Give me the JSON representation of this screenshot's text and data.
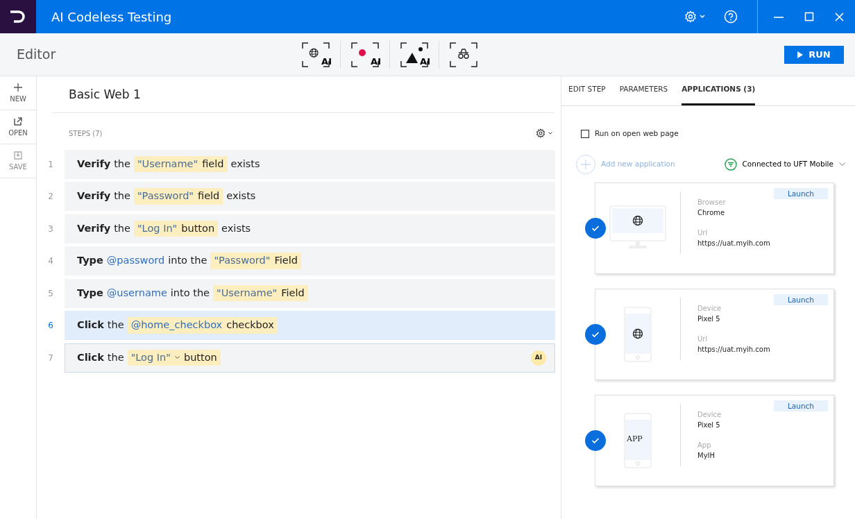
{
  "window": {
    "title": "AI Codeless Testing"
  },
  "toolbar": {
    "title": "Editor",
    "tools": [
      {
        "kind": "web",
        "label": "AI"
      },
      {
        "kind": "record",
        "label": "AI"
      },
      {
        "kind": "image",
        "label": "AI"
      },
      {
        "kind": "spy"
      }
    ],
    "run_button": "RUN"
  },
  "rail": [
    {
      "kind": "new",
      "label": "NEW",
      "disabled": false
    },
    {
      "kind": "open",
      "label": "OPEN",
      "disabled": false
    },
    {
      "kind": "save",
      "label": "SAVE",
      "disabled": true
    }
  ],
  "test": {
    "name": "Basic Web 1",
    "steps_label": "STEPS (7)"
  },
  "steps": [
    {
      "number": "1",
      "selected": false,
      "focused": false,
      "parts": [
        {
          "kind": "action",
          "text": "Verify"
        },
        {
          "kind": "text",
          "text": "the"
        },
        {
          "kind": "chip",
          "parts": [
            {
              "kind": "value",
              "text": "\"Username\""
            },
            {
              "kind": "text",
              "text": "field"
            }
          ]
        },
        {
          "kind": "text",
          "text": "exists"
        }
      ]
    },
    {
      "number": "2",
      "selected": false,
      "focused": false,
      "parts": [
        {
          "kind": "action",
          "text": "Verify"
        },
        {
          "kind": "text",
          "text": "the"
        },
        {
          "kind": "chip",
          "parts": [
            {
              "kind": "value",
              "text": "\"Password\""
            },
            {
              "kind": "text",
              "text": "field"
            }
          ]
        },
        {
          "kind": "text",
          "text": "exists"
        }
      ]
    },
    {
      "number": "3",
      "selected": false,
      "focused": false,
      "parts": [
        {
          "kind": "action",
          "text": "Verify"
        },
        {
          "kind": "text",
          "text": "the"
        },
        {
          "kind": "chip",
          "parts": [
            {
              "kind": "value",
              "text": "\"Log In\""
            },
            {
              "kind": "text",
              "text": "button"
            }
          ]
        },
        {
          "kind": "text",
          "text": "exists"
        }
      ]
    },
    {
      "number": "4",
      "selected": false,
      "focused": false,
      "parts": [
        {
          "kind": "action",
          "text": "Type"
        },
        {
          "kind": "param",
          "text": "@password"
        },
        {
          "kind": "text",
          "text": "into the"
        },
        {
          "kind": "chip",
          "parts": [
            {
              "kind": "value",
              "text": "\"Password\""
            },
            {
              "kind": "text",
              "text": "Field"
            }
          ]
        }
      ]
    },
    {
      "number": "5",
      "selected": false,
      "focused": false,
      "parts": [
        {
          "kind": "action",
          "text": "Type"
        },
        {
          "kind": "param",
          "text": "@username"
        },
        {
          "kind": "text",
          "text": "into the"
        },
        {
          "kind": "chip",
          "parts": [
            {
              "kind": "value",
              "text": "\"Username\""
            },
            {
              "kind": "text",
              "text": "Field"
            }
          ]
        }
      ]
    },
    {
      "number": "6",
      "selected": true,
      "focused": false,
      "parts": [
        {
          "kind": "action",
          "text": "Click"
        },
        {
          "kind": "text",
          "text": "the"
        },
        {
          "kind": "chip",
          "parts": [
            {
              "kind": "param",
              "text": "@home_checkbox"
            },
            {
              "kind": "text",
              "text": "checkbox"
            }
          ]
        }
      ]
    },
    {
      "number": "7",
      "selected": false,
      "focused": true,
      "badge": "AI",
      "parts": [
        {
          "kind": "action",
          "text": "Click"
        },
        {
          "kind": "text",
          "text": "the"
        },
        {
          "kind": "chip",
          "parts": [
            {
              "kind": "value",
              "text": "\"Log In\""
            },
            {
              "kind": "caret"
            },
            {
              "kind": "text",
              "text": "button"
            }
          ]
        }
      ]
    }
  ],
  "panel": {
    "tabs": [
      {
        "label": "EDIT STEP",
        "selected": false
      },
      {
        "label": "PARAMETERS",
        "selected": false
      },
      {
        "label": "APPLICATIONS (3)",
        "selected": true
      }
    ],
    "run_on_open": {
      "label": "Run on open web page",
      "checked": false
    },
    "add_app": {
      "label": "Add new application",
      "disabled": true
    },
    "connection": {
      "label": "Connected to UFT Mobile"
    },
    "apps": [
      {
        "kind": "browser",
        "checked": true,
        "launch": "Launch",
        "fields": [
          {
            "label": "Browser",
            "value": "Chrome"
          },
          {
            "label": "Url",
            "value": "https://uat.myih.com"
          }
        ]
      },
      {
        "kind": "mobile_web",
        "checked": true,
        "launch": "Launch",
        "fields": [
          {
            "label": "Device",
            "value": "Pixel 5"
          },
          {
            "label": "Url",
            "value": "https://uat.myih.com"
          }
        ]
      },
      {
        "kind": "mobile_app",
        "checked": true,
        "launch": "Launch",
        "app_label": "APP",
        "fields": [
          {
            "label": "Device",
            "value": "Pixel 5"
          },
          {
            "label": "App",
            "value": "MyIH"
          }
        ]
      }
    ]
  }
}
